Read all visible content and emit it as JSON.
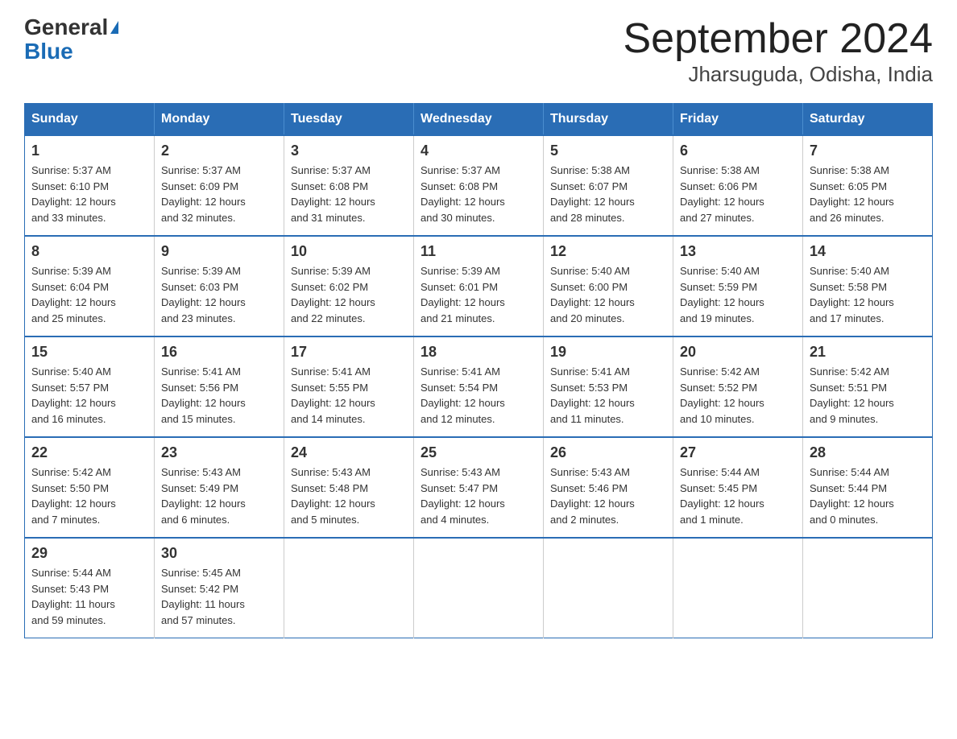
{
  "logo": {
    "text1": "General",
    "text2": "Blue"
  },
  "title": "September 2024",
  "subtitle": "Jharsuguda, Odisha, India",
  "weekdays": [
    "Sunday",
    "Monday",
    "Tuesday",
    "Wednesday",
    "Thursday",
    "Friday",
    "Saturday"
  ],
  "weeks": [
    [
      {
        "day": "1",
        "sunrise": "5:37 AM",
        "sunset": "6:10 PM",
        "daylight": "12 hours and 33 minutes."
      },
      {
        "day": "2",
        "sunrise": "5:37 AM",
        "sunset": "6:09 PM",
        "daylight": "12 hours and 32 minutes."
      },
      {
        "day": "3",
        "sunrise": "5:37 AM",
        "sunset": "6:08 PM",
        "daylight": "12 hours and 31 minutes."
      },
      {
        "day": "4",
        "sunrise": "5:37 AM",
        "sunset": "6:08 PM",
        "daylight": "12 hours and 30 minutes."
      },
      {
        "day": "5",
        "sunrise": "5:38 AM",
        "sunset": "6:07 PM",
        "daylight": "12 hours and 28 minutes."
      },
      {
        "day": "6",
        "sunrise": "5:38 AM",
        "sunset": "6:06 PM",
        "daylight": "12 hours and 27 minutes."
      },
      {
        "day": "7",
        "sunrise": "5:38 AM",
        "sunset": "6:05 PM",
        "daylight": "12 hours and 26 minutes."
      }
    ],
    [
      {
        "day": "8",
        "sunrise": "5:39 AM",
        "sunset": "6:04 PM",
        "daylight": "12 hours and 25 minutes."
      },
      {
        "day": "9",
        "sunrise": "5:39 AM",
        "sunset": "6:03 PM",
        "daylight": "12 hours and 23 minutes."
      },
      {
        "day": "10",
        "sunrise": "5:39 AM",
        "sunset": "6:02 PM",
        "daylight": "12 hours and 22 minutes."
      },
      {
        "day": "11",
        "sunrise": "5:39 AM",
        "sunset": "6:01 PM",
        "daylight": "12 hours and 21 minutes."
      },
      {
        "day": "12",
        "sunrise": "5:40 AM",
        "sunset": "6:00 PM",
        "daylight": "12 hours and 20 minutes."
      },
      {
        "day": "13",
        "sunrise": "5:40 AM",
        "sunset": "5:59 PM",
        "daylight": "12 hours and 19 minutes."
      },
      {
        "day": "14",
        "sunrise": "5:40 AM",
        "sunset": "5:58 PM",
        "daylight": "12 hours and 17 minutes."
      }
    ],
    [
      {
        "day": "15",
        "sunrise": "5:40 AM",
        "sunset": "5:57 PM",
        "daylight": "12 hours and 16 minutes."
      },
      {
        "day": "16",
        "sunrise": "5:41 AM",
        "sunset": "5:56 PM",
        "daylight": "12 hours and 15 minutes."
      },
      {
        "day": "17",
        "sunrise": "5:41 AM",
        "sunset": "5:55 PM",
        "daylight": "12 hours and 14 minutes."
      },
      {
        "day": "18",
        "sunrise": "5:41 AM",
        "sunset": "5:54 PM",
        "daylight": "12 hours and 12 minutes."
      },
      {
        "day": "19",
        "sunrise": "5:41 AM",
        "sunset": "5:53 PM",
        "daylight": "12 hours and 11 minutes."
      },
      {
        "day": "20",
        "sunrise": "5:42 AM",
        "sunset": "5:52 PM",
        "daylight": "12 hours and 10 minutes."
      },
      {
        "day": "21",
        "sunrise": "5:42 AM",
        "sunset": "5:51 PM",
        "daylight": "12 hours and 9 minutes."
      }
    ],
    [
      {
        "day": "22",
        "sunrise": "5:42 AM",
        "sunset": "5:50 PM",
        "daylight": "12 hours and 7 minutes."
      },
      {
        "day": "23",
        "sunrise": "5:43 AM",
        "sunset": "5:49 PM",
        "daylight": "12 hours and 6 minutes."
      },
      {
        "day": "24",
        "sunrise": "5:43 AM",
        "sunset": "5:48 PM",
        "daylight": "12 hours and 5 minutes."
      },
      {
        "day": "25",
        "sunrise": "5:43 AM",
        "sunset": "5:47 PM",
        "daylight": "12 hours and 4 minutes."
      },
      {
        "day": "26",
        "sunrise": "5:43 AM",
        "sunset": "5:46 PM",
        "daylight": "12 hours and 2 minutes."
      },
      {
        "day": "27",
        "sunrise": "5:44 AM",
        "sunset": "5:45 PM",
        "daylight": "12 hours and 1 minute."
      },
      {
        "day": "28",
        "sunrise": "5:44 AM",
        "sunset": "5:44 PM",
        "daylight": "12 hours and 0 minutes."
      }
    ],
    [
      {
        "day": "29",
        "sunrise": "5:44 AM",
        "sunset": "5:43 PM",
        "daylight": "11 hours and 59 minutes."
      },
      {
        "day": "30",
        "sunrise": "5:45 AM",
        "sunset": "5:42 PM",
        "daylight": "11 hours and 57 minutes."
      },
      null,
      null,
      null,
      null,
      null
    ]
  ],
  "labels": {
    "sunrise": "Sunrise:",
    "sunset": "Sunset:",
    "daylight": "Daylight:"
  }
}
